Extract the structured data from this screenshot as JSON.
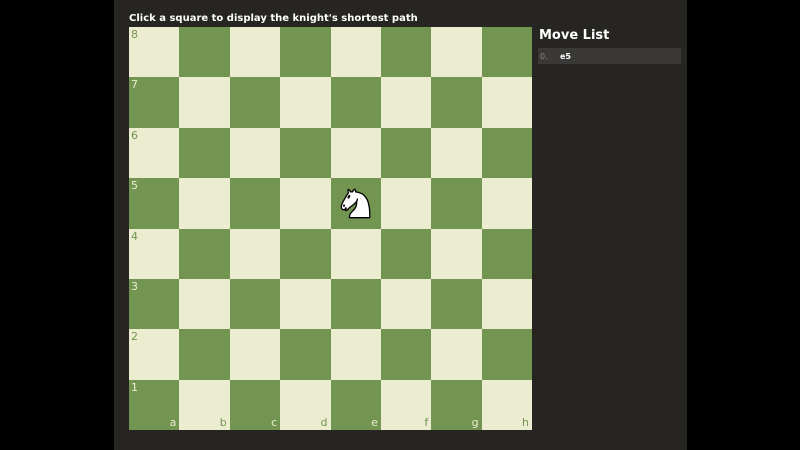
{
  "instruction": "Click a square to display the knight's shortest path",
  "colors": {
    "app_bg": "#262522",
    "light_square": "#ebecd0",
    "dark_square": "#739552"
  },
  "board": {
    "files": [
      "a",
      "b",
      "c",
      "d",
      "e",
      "f",
      "g",
      "h"
    ],
    "ranks": [
      "8",
      "7",
      "6",
      "5",
      "4",
      "3",
      "2",
      "1"
    ],
    "pieces": [
      {
        "square": "e5",
        "type": "knight",
        "color": "white",
        "icon": "white-knight-icon"
      }
    ]
  },
  "move_list": {
    "title": "Move List",
    "moves": [
      {
        "number": "0.",
        "san": "e5"
      }
    ]
  }
}
